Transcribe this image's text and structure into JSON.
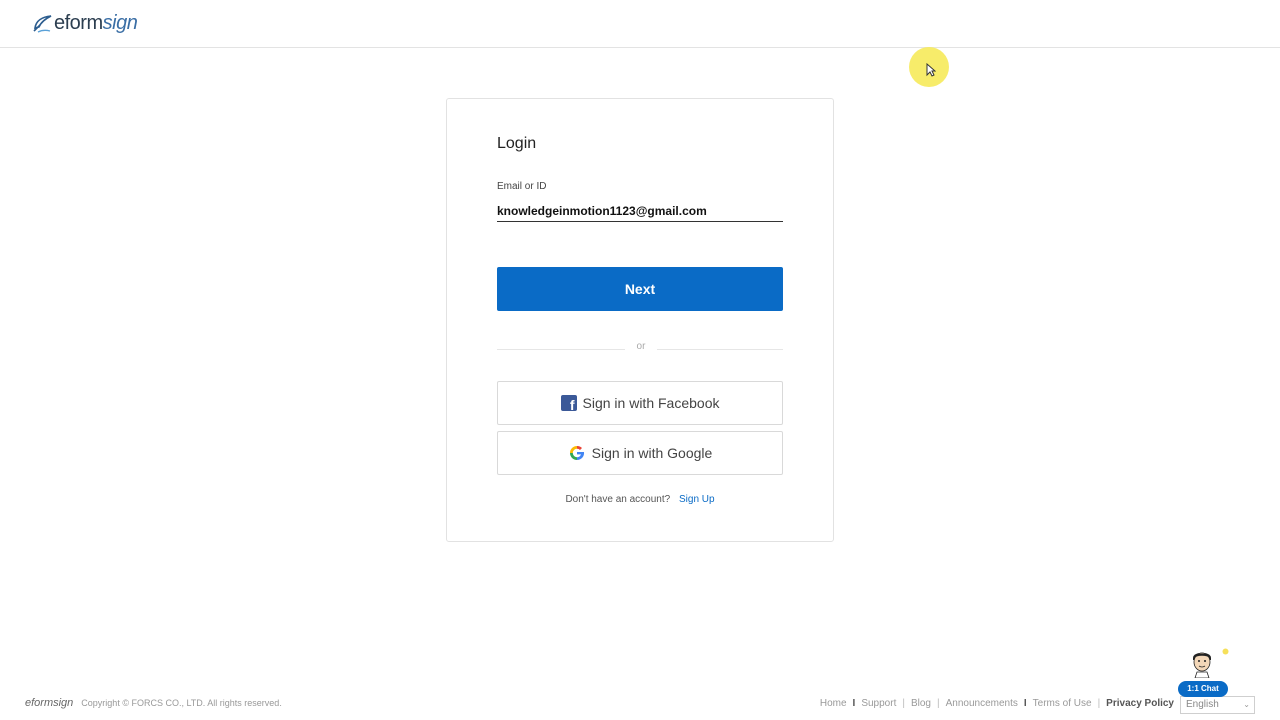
{
  "header": {
    "logo_prefix": "eform",
    "logo_suffix": "sign"
  },
  "login": {
    "title": "Login",
    "email_label": "Email or ID",
    "email_value": "knowledgeinmotion1123@gmail.com",
    "next_label": "Next",
    "or_text": "or",
    "facebook_label": "Sign in with Facebook",
    "google_label": "Sign in with Google",
    "no_account_text": "Don't have an account?",
    "signup_label": "Sign Up"
  },
  "footer": {
    "logo_text": "eformsign",
    "copyright": "Copyright © FORCS CO., LTD. All rights reserved.",
    "links": [
      "Home",
      "Support",
      "Blog",
      "Announcements",
      "Terms of Use",
      "Privacy Policy"
    ],
    "language": "English"
  },
  "chat": {
    "label": "1:1 Chat"
  },
  "colors": {
    "primary": "#0a6bc6",
    "facebook": "#3b5998",
    "cursor_highlight": "#f6ea5a"
  }
}
